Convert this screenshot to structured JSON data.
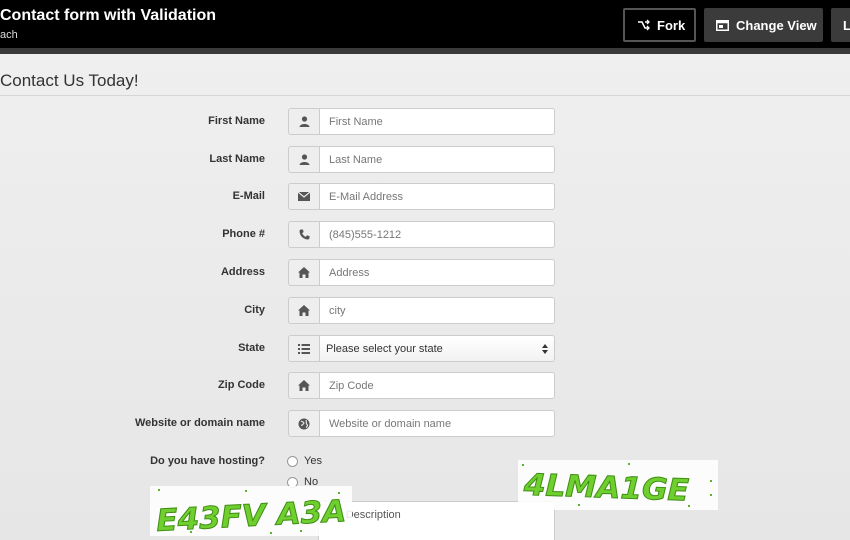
{
  "header": {
    "title": "Contact form with Validation",
    "author": "ach",
    "buttons": {
      "fork": "Fork",
      "change_view": "Change View",
      "more": "L"
    }
  },
  "form": {
    "legend": "Contact Us Today!",
    "fields": {
      "first_name": {
        "label": "First Name",
        "placeholder": "First Name",
        "icon": "user-icon"
      },
      "last_name": {
        "label": "Last Name",
        "placeholder": "Last Name",
        "icon": "user-icon"
      },
      "email": {
        "label": "E-Mail",
        "placeholder": "E-Mail Address",
        "icon": "envelope-icon"
      },
      "phone": {
        "label": "Phone #",
        "placeholder": "(845)555-1212",
        "icon": "phone-icon"
      },
      "address": {
        "label": "Address",
        "placeholder": "Address",
        "icon": "home-icon"
      },
      "city": {
        "label": "City",
        "placeholder": "city",
        "icon": "home-icon"
      },
      "state": {
        "label": "State",
        "selected": "Please select your state",
        "icon": "list-icon"
      },
      "zip": {
        "label": "Zip Code",
        "placeholder": "Zip Code",
        "icon": "home-icon"
      },
      "website": {
        "label": "Website or domain name",
        "placeholder": "Website or domain name",
        "icon": "globe-icon"
      }
    },
    "hosting": {
      "label": "Do you have hosting?",
      "options": [
        "Yes",
        "No"
      ]
    },
    "description_placeholder": "ect Description"
  },
  "captchas": [
    "E43FV A3A",
    "4LMA1GE"
  ],
  "colors": {
    "topbar": "#000000",
    "button_dark": "#3b3b3b",
    "captcha_green": "#5fbf2a"
  }
}
